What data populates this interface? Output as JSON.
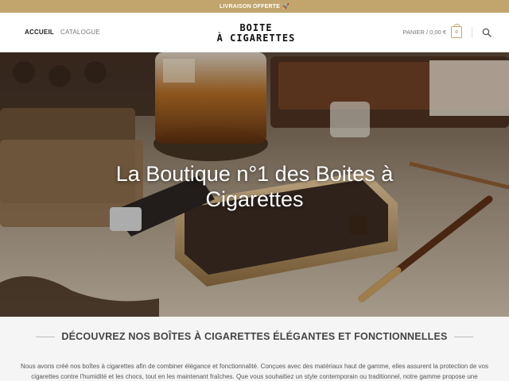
{
  "topbar": {
    "text": "LIVRAISON OFFERTE",
    "emoji": "🚀"
  },
  "nav": {
    "items": [
      {
        "label": "ACCUEIL"
      },
      {
        "label": "CATALOGUE"
      }
    ]
  },
  "logo": {
    "line1": "BOITE",
    "line2": "À CIGARETTES"
  },
  "cart": {
    "label": "PANIER / 0,00 €",
    "count": "0"
  },
  "hero": {
    "title_line1": "La Boutique n°1 des Boites à",
    "title_line2": "Cigarettes"
  },
  "intro": {
    "title": "DÉCOUVREZ NOS BOÎTES À CIGARETTES ÉLÉGANTES ET FONCTIONNELLES",
    "line1": "Nous avons créé nos boîtes à cigarettes afin de combiner élégance et fonctionnalité. Conçues avec des matériaux haut de gamme, elles assurent la protection de vos",
    "line2": "cigarettes contre l'humidité et les chocs, tout en les maintenant fraîches. Que vous souhaitiez un style contemporain ou traditionnel, notre gamme propose une"
  },
  "colors": {
    "accent": "#c1a56d",
    "topbar_bg": "#c1a56d",
    "intro_bg": "#f5f5f5"
  }
}
